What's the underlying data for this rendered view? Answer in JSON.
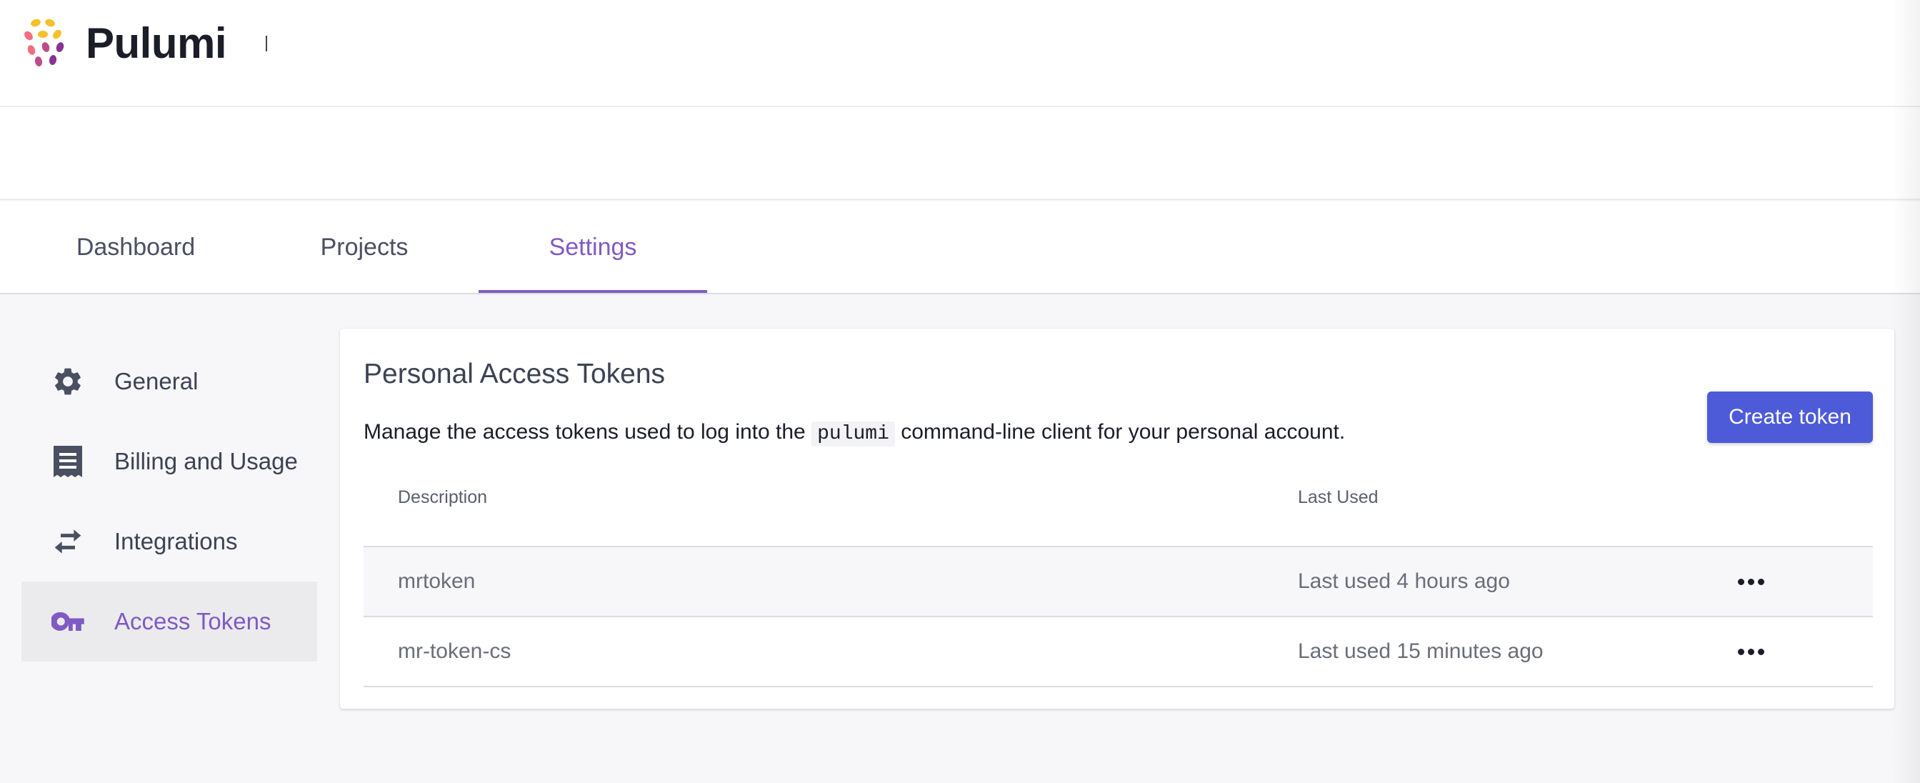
{
  "brand": {
    "name": "Pulumi"
  },
  "tabs": [
    {
      "label": "Dashboard"
    },
    {
      "label": "Projects"
    },
    {
      "label": "Settings",
      "active": true
    }
  ],
  "sidebar": {
    "items": [
      {
        "label": "General",
        "icon": "gear-icon"
      },
      {
        "label": "Billing and Usage",
        "icon": "receipt-icon"
      },
      {
        "label": "Integrations",
        "icon": "swap-arrows-icon"
      },
      {
        "label": "Access Tokens",
        "icon": "key-icon",
        "active": true
      }
    ]
  },
  "tokens_card": {
    "title": "Personal Access Tokens",
    "desc_before": "Manage the access tokens used to log into the ",
    "desc_code": "pulumi",
    "desc_after": " command-line client for your personal account.",
    "create_label": "Create token",
    "columns": [
      "Description",
      "Last Used"
    ],
    "rows": [
      {
        "description": "mrtoken",
        "last_used": "Last used 4 hours ago"
      },
      {
        "description": "mr-token-cs",
        "last_used": "Last used 15 minutes ago"
      }
    ]
  },
  "colors": {
    "accent": "#805ac3",
    "button": "#4d5bd9",
    "background": "#f7f7f9"
  }
}
